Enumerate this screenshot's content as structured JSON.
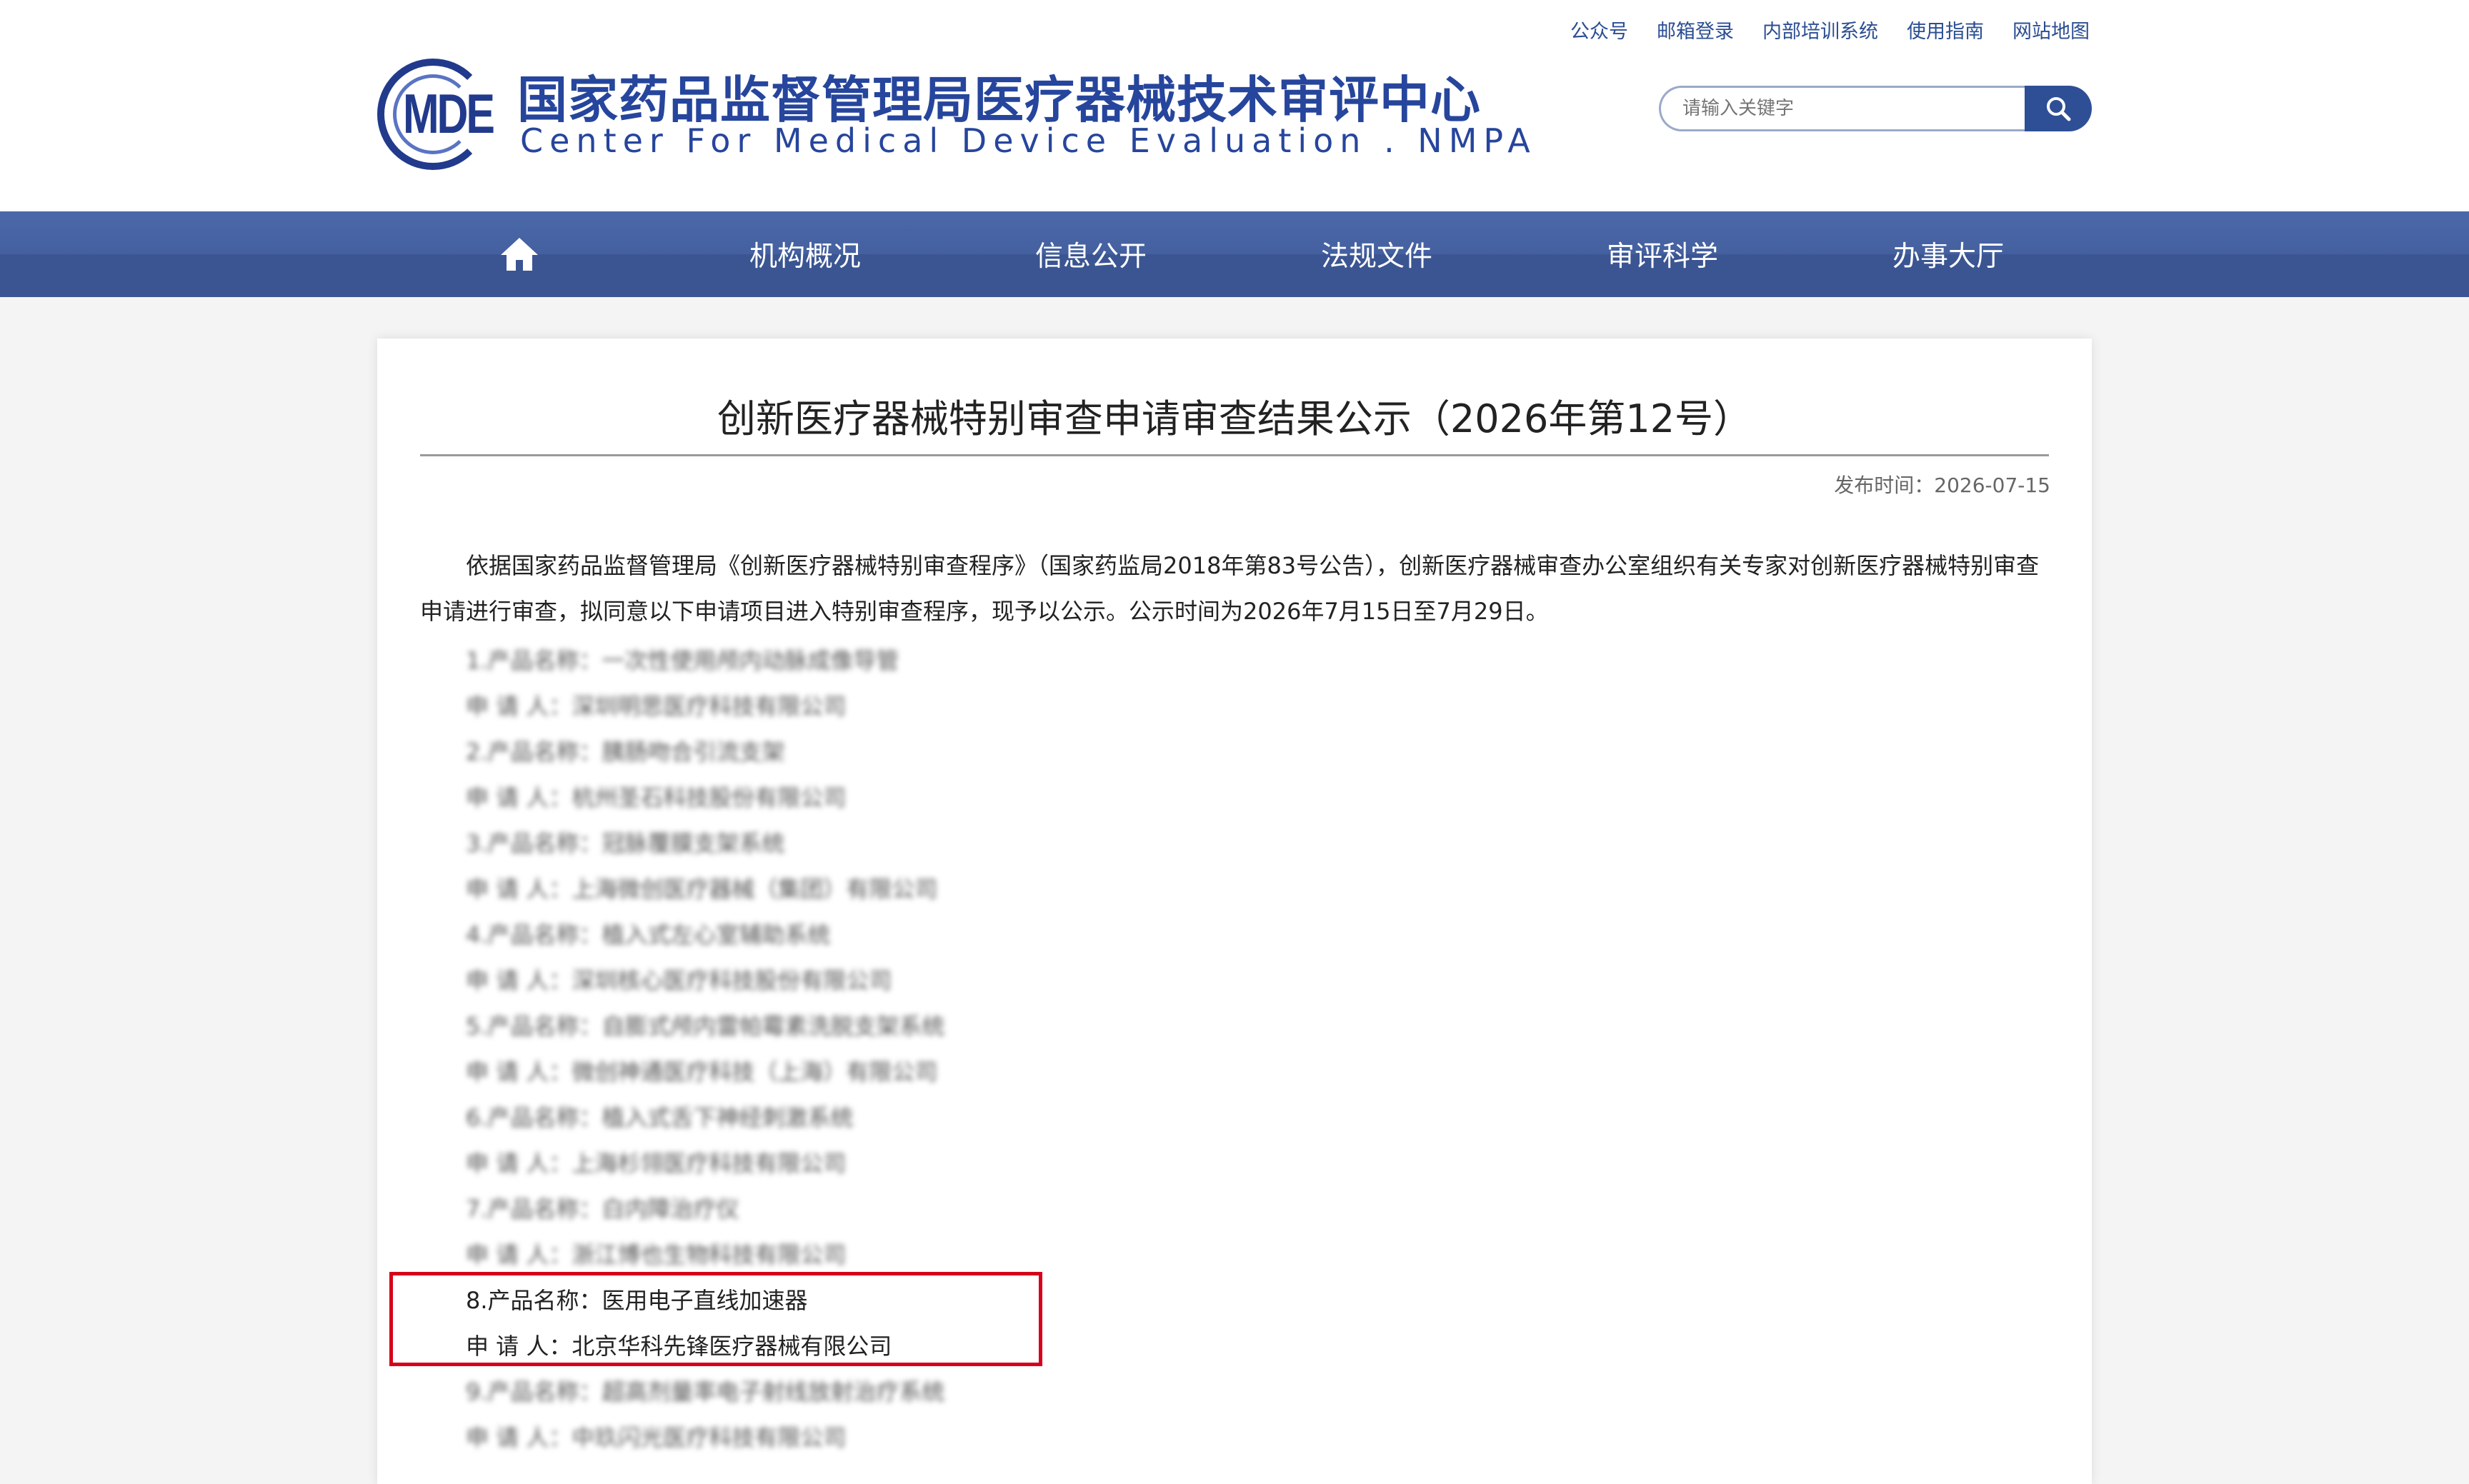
{
  "header": {
    "top_links": [
      "公众号",
      "邮箱登录",
      "内部培训系统",
      "使用指南",
      "网站地图"
    ],
    "logo_abbr": "MDE",
    "logo_cn": "国家药品监督管理局医疗器械技术审评中心",
    "logo_en": "Center For Medical Device Evaluation . NMPA",
    "search_placeholder": "请输入关键字"
  },
  "nav": {
    "items": [
      "机构概况",
      "信息公开",
      "法规文件",
      "审评科学",
      "办事大厅"
    ]
  },
  "article": {
    "title": "创新医疗器械特别审查申请审查结果公示（2026年第12号）",
    "publish_time": "发布时间：2026-07-15",
    "intro": "依据国家药品监督管理局《创新医疗器械特别审查程序》（国家药监局2018年第83号公告），创新医疗器械审查办公室组织有关专家对创新医疗器械特别审查申请进行审查，拟同意以下申请项目进入特别审查程序，现予以公示。公示时间为2026年7月15日至7月29日。",
    "items": [
      {
        "product": "1.产品名称：一次性使用颅内动脉成像导管",
        "applicant": "申 请 人：深圳明思医疗科技有限公司"
      },
      {
        "product": "2.产品名称：胰肠吻合引流支架",
        "applicant": "申 请 人：杭州圣石科技股份有限公司"
      },
      {
        "product": "3.产品名称：冠脉覆膜支架系统",
        "applicant": "申 请 人：上海微创医疗器械（集团）有限公司"
      },
      {
        "product": "4.产品名称：植入式左心室辅助系统",
        "applicant": "申 请 人：深圳核心医疗科技股份有限公司"
      },
      {
        "product": "5.产品名称：自膨式颅内雷帕霉素洗脱支架系统",
        "applicant": "申 请 人：微创神通医疗科技（上海）有限公司"
      },
      {
        "product": "6.产品名称：植入式舌下神经刺激系统",
        "applicant": "申 请 人：上海杉翎医疗科技有限公司"
      },
      {
        "product": "7.产品名称：白内障治疗仪",
        "applicant": "申 请 人：浙江博也生物科技有限公司"
      },
      {
        "product": "8.产品名称：医用电子直线加速器",
        "applicant": "申 请 人：北京华科先锋医疗器械有限公司"
      },
      {
        "product": "9.产品名称：超高剂量率电子射线放射治疗系统",
        "applicant": "申 请 人：中玖闪光医疗科技有限公司"
      }
    ]
  }
}
